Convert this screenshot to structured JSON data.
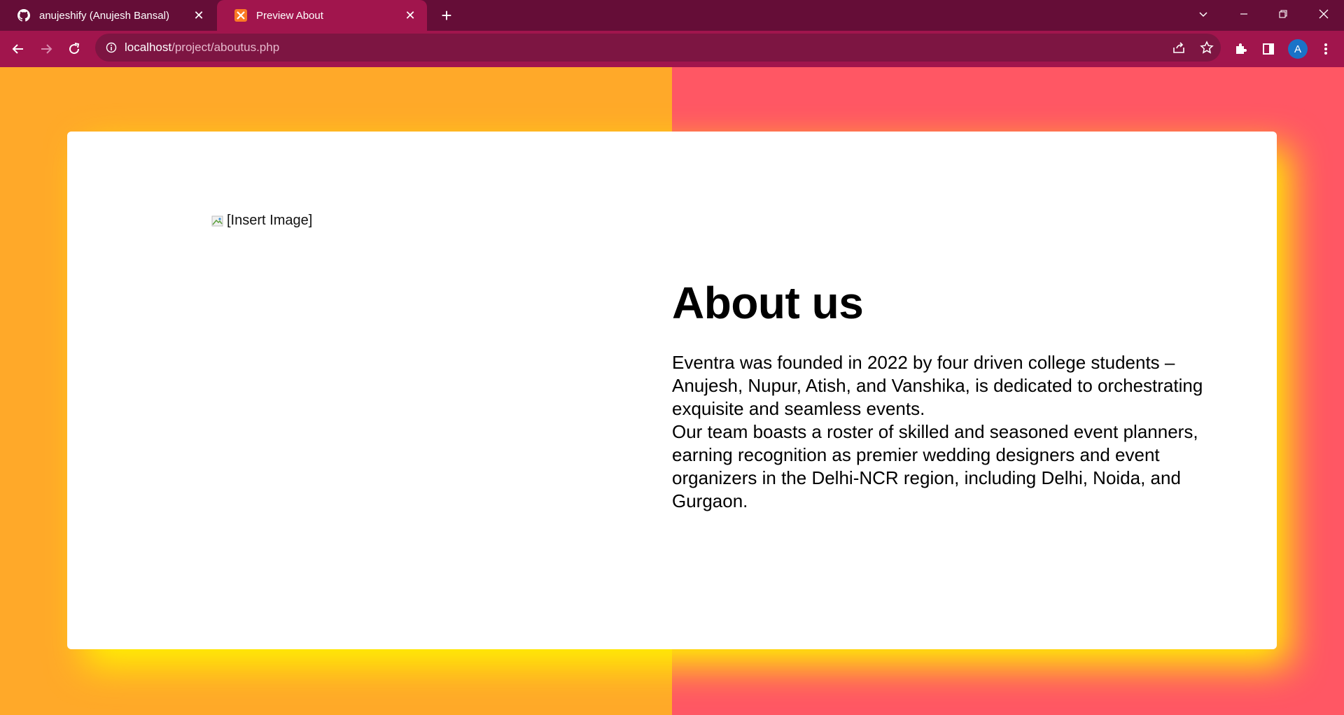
{
  "browser": {
    "tabs": [
      {
        "title": "anujeshify (Anujesh Bansal)",
        "icon": "github-icon",
        "active": false
      },
      {
        "title": "Preview About",
        "icon": "xampp-icon",
        "active": true
      }
    ],
    "address": {
      "host": "localhost",
      "path": "/project/aboutus.php"
    },
    "profile_initial": "A",
    "colors": {
      "tabstrip": "#650d37",
      "toolbar": "#a1154d",
      "omnibox": "#7d1542"
    }
  },
  "page": {
    "colors": {
      "left_bg": "#ffa929",
      "right_bg": "#ff5764",
      "glow": "#fff200",
      "card": "#ffffff"
    },
    "image_alt": "[Insert Image]",
    "heading": "About us",
    "paragraph_lines": [
      "Eventra was founded in 2022 by four driven college students –",
      "Anujesh, Nupur, Atish, and Vanshika, is dedicated to orchestrating",
      "exquisite and seamless events.",
      "Our team boasts a roster of skilled and seasoned event planners,",
      "earning recognition as premier wedding designers and event",
      "organizers in the Delhi-NCR region, including Delhi, Noida, and",
      "Gurgaon."
    ]
  }
}
